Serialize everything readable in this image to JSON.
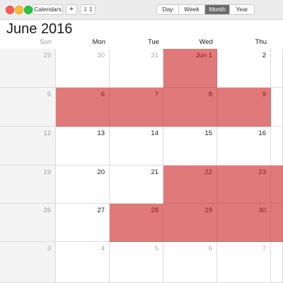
{
  "toolbar": {
    "calendars_label": "Calendars",
    "add_label": "+",
    "inbox_label": "⇩ 1",
    "views": [
      "Day",
      "Week",
      "Month",
      "Year"
    ],
    "selected_view": "Month"
  },
  "header": {
    "month": "June",
    "year": "2016"
  },
  "weekdays": [
    "Sun",
    "Mon",
    "Tue",
    "Wed",
    "Thu"
  ],
  "weeks": [
    [
      {
        "label": "29",
        "outside": true,
        "event": false
      },
      {
        "label": "30",
        "outside": true,
        "event": false
      },
      {
        "label": "31",
        "outside": true,
        "event": false
      },
      {
        "label": "Jun 1",
        "outside": false,
        "event": true
      },
      {
        "label": "2",
        "outside": false,
        "event": false
      },
      {
        "label": "",
        "outside": false,
        "event": false
      }
    ],
    [
      {
        "label": "5",
        "outside": false,
        "event": false
      },
      {
        "label": "6",
        "outside": false,
        "event": true
      },
      {
        "label": "7",
        "outside": false,
        "event": true
      },
      {
        "label": "8",
        "outside": false,
        "event": true
      },
      {
        "label": "9",
        "outside": false,
        "event": true
      },
      {
        "label": "",
        "outside": false,
        "event": false
      }
    ],
    [
      {
        "label": "12",
        "outside": false,
        "event": false
      },
      {
        "label": "13",
        "outside": false,
        "event": false
      },
      {
        "label": "14",
        "outside": false,
        "event": false
      },
      {
        "label": "15",
        "outside": false,
        "event": false
      },
      {
        "label": "16",
        "outside": false,
        "event": false
      },
      {
        "label": "",
        "outside": false,
        "event": false
      }
    ],
    [
      {
        "label": "19",
        "outside": false,
        "event": false
      },
      {
        "label": "20",
        "outside": false,
        "event": false
      },
      {
        "label": "21",
        "outside": false,
        "event": false
      },
      {
        "label": "22",
        "outside": false,
        "event": true
      },
      {
        "label": "23",
        "outside": false,
        "event": true
      },
      {
        "label": "",
        "outside": false,
        "event": true
      }
    ],
    [
      {
        "label": "26",
        "outside": false,
        "event": false
      },
      {
        "label": "27",
        "outside": false,
        "event": false
      },
      {
        "label": "28",
        "outside": false,
        "event": true
      },
      {
        "label": "29",
        "outside": false,
        "event": true
      },
      {
        "label": "30",
        "outside": false,
        "event": true
      },
      {
        "label": "",
        "outside": false,
        "event": true
      }
    ],
    [
      {
        "label": "3",
        "outside": true,
        "event": false
      },
      {
        "label": "4",
        "outside": true,
        "event": false
      },
      {
        "label": "5",
        "outside": true,
        "event": false
      },
      {
        "label": "6",
        "outside": true,
        "event": false
      },
      {
        "label": "7",
        "outside": true,
        "event": false
      },
      {
        "label": "",
        "outside": true,
        "event": false
      }
    ]
  ],
  "colors": {
    "event_fill": "#e07a7a",
    "event_text": "#8c1a1a",
    "sunday_bg": "#f4f4f4",
    "selected_view_bg": "#6b6b6b"
  }
}
